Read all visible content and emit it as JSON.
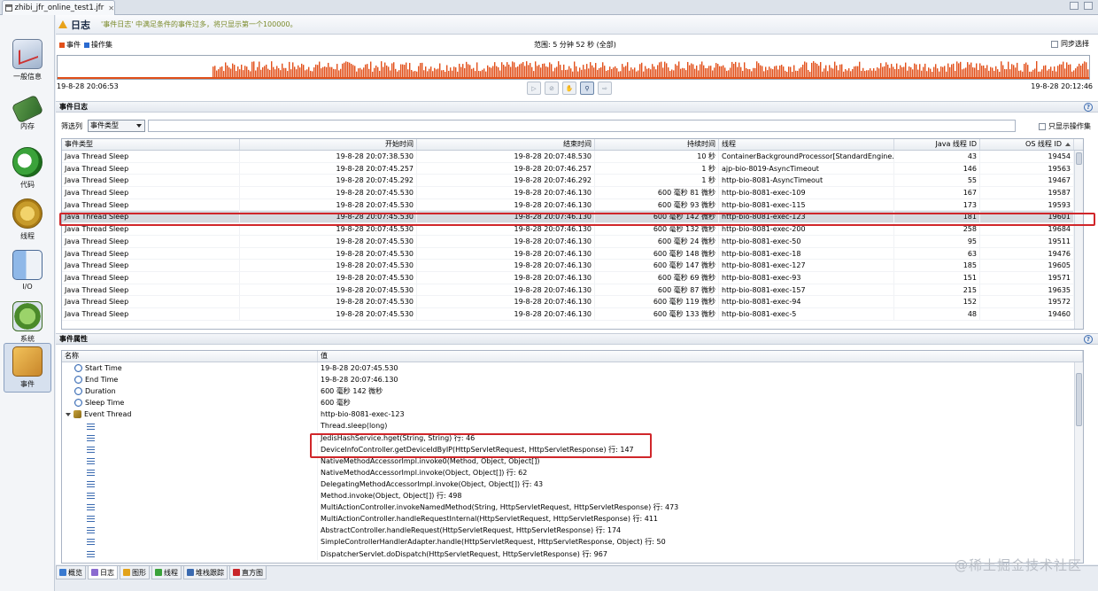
{
  "editor_tab": {
    "title": "zhibi_jfr_online_test1.jfr",
    "close": "✕"
  },
  "nav": [
    {
      "label": "一般信息",
      "icon": "chart-icon"
    },
    {
      "label": "内存",
      "icon": "memory-icon"
    },
    {
      "label": "代码",
      "icon": "code-icon"
    },
    {
      "label": "线程",
      "icon": "thread-icon"
    },
    {
      "label": "I/O",
      "icon": "io-icon"
    },
    {
      "label": "系统",
      "icon": "system-icon"
    },
    {
      "label": "事件",
      "icon": "events-icon",
      "active": true
    }
  ],
  "header": {
    "title": "日志",
    "message": "'事件日志' 中满足条件的事件过多，将只显示第一个100000。"
  },
  "timeline": {
    "legend_events": "事件",
    "legend_ops": "操作集",
    "range": "范围: 5 分钟 52 秒 (全部)",
    "sync_label": "同步选择",
    "start_time": "19-8-28 20:06:53",
    "end_time": "19-8-28 20:12:46",
    "activity_start_fraction": 0.15,
    "color_events": "#e2501a",
    "color_ops": "#2a6ad0"
  },
  "event_log": {
    "section_title": "事件日志",
    "filter_label": "筛选列",
    "filter_value": "事件类型",
    "only_ops_label": "只显示操作集",
    "columns": [
      "事件类型",
      "开始时间",
      "结束时间",
      "持续时间",
      "线程",
      "Java 线程 ID",
      "OS 线程 ID"
    ],
    "rows": [
      [
        "Java Thread Sleep",
        "19-8-28 20:07:38.530",
        "19-8-28 20:07:48.530",
        "10 秒",
        "ContainerBackgroundProcessor[StandardEngine...",
        "43",
        "19454"
      ],
      [
        "Java Thread Sleep",
        "19-8-28 20:07:45.257",
        "19-8-28 20:07:46.257",
        "1 秒",
        "ajp-bio-8019-AsyncTimeout",
        "146",
        "19563"
      ],
      [
        "Java Thread Sleep",
        "19-8-28 20:07:45.292",
        "19-8-28 20:07:46.292",
        "1 秒",
        "http-bio-8081-AsyncTimeout",
        "55",
        "19467"
      ],
      [
        "Java Thread Sleep",
        "19-8-28 20:07:45.530",
        "19-8-28 20:07:46.130",
        "600 毫秒 81 微秒",
        "http-bio-8081-exec-109",
        "167",
        "19587"
      ],
      [
        "Java Thread Sleep",
        "19-8-28 20:07:45.530",
        "19-8-28 20:07:46.130",
        "600 毫秒 93 微秒",
        "http-bio-8081-exec-115",
        "173",
        "19593"
      ],
      [
        "Java Thread Sleep",
        "19-8-28 20:07:45.530",
        "19-8-28 20:07:46.130",
        "600 毫秒 142 微秒",
        "http-bio-8081-exec-123",
        "181",
        "19601"
      ],
      [
        "Java Thread Sleep",
        "19-8-28 20:07:45.530",
        "19-8-28 20:07:46.130",
        "600 毫秒 132 微秒",
        "http-bio-8081-exec-200",
        "258",
        "19684"
      ],
      [
        "Java Thread Sleep",
        "19-8-28 20:07:45.530",
        "19-8-28 20:07:46.130",
        "600 毫秒 24 微秒",
        "http-bio-8081-exec-50",
        "95",
        "19511"
      ],
      [
        "Java Thread Sleep",
        "19-8-28 20:07:45.530",
        "19-8-28 20:07:46.130",
        "600 毫秒 148 微秒",
        "http-bio-8081-exec-18",
        "63",
        "19476"
      ],
      [
        "Java Thread Sleep",
        "19-8-28 20:07:45.530",
        "19-8-28 20:07:46.130",
        "600 毫秒 147 微秒",
        "http-bio-8081-exec-127",
        "185",
        "19605"
      ],
      [
        "Java Thread Sleep",
        "19-8-28 20:07:45.530",
        "19-8-28 20:07:46.130",
        "600 毫秒 69 微秒",
        "http-bio-8081-exec-93",
        "151",
        "19571"
      ],
      [
        "Java Thread Sleep",
        "19-8-28 20:07:45.530",
        "19-8-28 20:07:46.130",
        "600 毫秒 87 微秒",
        "http-bio-8081-exec-157",
        "215",
        "19635"
      ],
      [
        "Java Thread Sleep",
        "19-8-28 20:07:45.530",
        "19-8-28 20:07:46.130",
        "600 毫秒 119 微秒",
        "http-bio-8081-exec-94",
        "152",
        "19572"
      ],
      [
        "Java Thread Sleep",
        "19-8-28 20:07:45.530",
        "19-8-28 20:07:46.130",
        "600 毫秒 133 微秒",
        "http-bio-8081-exec-5",
        "48",
        "19460"
      ]
    ],
    "selected_row": 5
  },
  "event_props": {
    "section_title": "事件属性",
    "columns": [
      "名称",
      "值"
    ],
    "rows": [
      {
        "name": "Start Time",
        "value": "19-8-28 20:07:45.530",
        "icon": "clock-icon"
      },
      {
        "name": "End Time",
        "value": "19-8-28 20:07:46.130",
        "icon": "clock-icon"
      },
      {
        "name": "Duration",
        "value": "600 毫秒 142 微秒",
        "icon": "clock-icon"
      },
      {
        "name": "Sleep Time",
        "value": "600 毫秒",
        "icon": "clock-icon"
      },
      {
        "name": "Event Thread",
        "value": "http-bio-8081-exec-123",
        "icon": "thread-icon"
      }
    ],
    "stack": [
      "Thread.sleep(long)",
      "JedisHashService.hget(String, String) 行: 46",
      "DeviceInfoController.getDeviceIdByIP(HttpServletRequest, HttpServletResponse) 行: 147",
      "NativeMethodAccessorImpl.invoke0(Method, Object, Object[])",
      "NativeMethodAccessorImpl.invoke(Object, Object[]) 行: 62",
      "DelegatingMethodAccessorImpl.invoke(Object, Object[]) 行: 43",
      "Method.invoke(Object, Object[]) 行: 498",
      "MultiActionController.invokeNamedMethod(String, HttpServletRequest, HttpServletResponse) 行: 473",
      "MultiActionController.handleRequestInternal(HttpServletRequest, HttpServletResponse) 行: 411",
      "AbstractController.handleRequest(HttpServletRequest, HttpServletResponse) 行: 174",
      "SimpleControllerHandlerAdapter.handle(HttpServletRequest, HttpServletResponse, Object) 行: 50",
      "DispatcherServlet.doDispatch(HttpServletRequest, HttpServletResponse) 行: 967"
    ]
  },
  "bottom_tabs": [
    {
      "label": "概览",
      "color": "#3a7ad0"
    },
    {
      "label": "日志",
      "color": "#8a6ad0",
      "active": true
    },
    {
      "label": "图形",
      "color": "#e2a21a"
    },
    {
      "label": "线程",
      "color": "#3aa23a"
    },
    {
      "label": "堆栈跟踪",
      "color": "#3a6ab0"
    },
    {
      "label": "直方图",
      "color": "#c8262a"
    }
  ],
  "watermark": "@稀土掘金技术社区"
}
